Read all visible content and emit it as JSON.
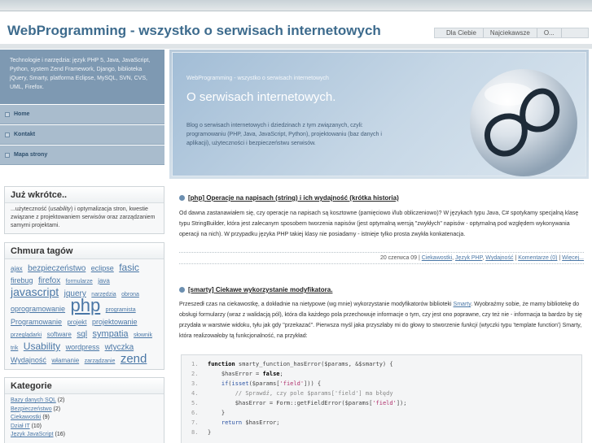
{
  "site": {
    "title": "WebProgramming - wszystko o serwisach internetowych",
    "top_nav": [
      "Dla Ciebie",
      "Najciekawsze",
      "O..."
    ]
  },
  "sidebar": {
    "intro": "Technologie i narzędzia: język PHP 5, Java, JavaScript, Python, system Zend Framework, Django, biblioteka jQuery, Smarty, platforma Eclipse, MySQL, SVN, CVS, UML, Firefox.",
    "nav": [
      "Home",
      "Kontakt",
      "Mapa strony"
    ],
    "soon": {
      "title": "Już wkrótce..",
      "text_before": "...użyteczność (",
      "text_em": "usability",
      "text_after": ") i optymalizacja stron, kwestie związane z projektowaniem serwisów oraz zarządzaniem samymi projektami."
    },
    "tags_title": "Chmura tagów",
    "tags": [
      {
        "label": "ajax",
        "size": 8
      },
      {
        "label": "bezpieczeństwo",
        "size": 10
      },
      {
        "label": "eclipse",
        "size": 9
      },
      {
        "label": "fasic",
        "size": 12
      },
      {
        "label": "firebug",
        "size": 9
      },
      {
        "label": "firefox",
        "size": 10
      },
      {
        "label": "formularze",
        "size": 7
      },
      {
        "label": "java",
        "size": 8
      },
      {
        "label": "javascript",
        "size": 14
      },
      {
        "label": "jquery",
        "size": 10
      },
      {
        "label": "narzędzia",
        "size": 7
      },
      {
        "label": "obrona",
        "size": 7
      },
      {
        "label": "oprogramowanie",
        "size": 9
      },
      {
        "label": "php",
        "size": 22
      },
      {
        "label": "programista",
        "size": 7
      },
      {
        "label": "Programowanie",
        "size": 9
      },
      {
        "label": "projekt",
        "size": 8
      },
      {
        "label": "projektowanie",
        "size": 9
      },
      {
        "label": "przeglądarki",
        "size": 7
      },
      {
        "label": "software",
        "size": 8
      },
      {
        "label": "sql",
        "size": 10
      },
      {
        "label": "sympatia",
        "size": 11
      },
      {
        "label": "słownik",
        "size": 7
      },
      {
        "label": "trik",
        "size": 7
      },
      {
        "label": "Usability",
        "size": 12
      },
      {
        "label": "wordpress",
        "size": 9
      },
      {
        "label": "wtyczka",
        "size": 10
      },
      {
        "label": "Wydajność",
        "size": 9
      },
      {
        "label": "włamanie",
        "size": 8
      },
      {
        "label": "zarządzanie",
        "size": 7
      },
      {
        "label": "zend",
        "size": 15
      }
    ],
    "categories_title": "Kategorie",
    "categories": [
      {
        "label": "Bazy danych SQL",
        "count": "(2)"
      },
      {
        "label": "Bezpieczeństwo",
        "count": "(2)"
      },
      {
        "label": "Ciekawostki",
        "count": "(9)"
      },
      {
        "label": "Dział IT",
        "count": "(10)"
      },
      {
        "label": "Język JavaScript",
        "count": "(16)"
      }
    ]
  },
  "banner": {
    "small": "WebProgramming - wszystko o serwisach internetowych",
    "title": "O serwisach internetowych.",
    "desc": "Blog o serwisach internetowych i dziedzinach z tym związanych, czyli: programowaniu (PHP, Java, JavaScript, Python), projektowaniu (baz danych i aplikacji), użyteczności i bezpieczeństwu serwisów."
  },
  "posts": [
    {
      "tag": "[php]",
      "title": "Operacje na napisach (string) i ich wydajność (krótka historia)",
      "body": "Od dawna zastanawiałem się, czy operacje na napisach są kosztowne (pamięciowo i/lub obliczeniowo)? W językach typu Java, C# spotykamy specjalną klasę typu StringBuilder, która jest zalecanym sposobem tworzenia napisów (jest optymalną wersją \"zwykłych\" napisów - optymalną pod względem wykonywania operacji na nich). W przypadku języka PHP takiej klasy nie posiadamy - istnieje tylko prosta zwykła konkatenacja.",
      "meta": {
        "date": "20 czerwca 09 |",
        "links": [
          "Ciekawostki",
          "Język PHP",
          "Wydajność",
          "Komentarze (0)",
          "Więcej..."
        ]
      }
    },
    {
      "tag": "[smarty]",
      "title": "Ciekawe wykorzystanie modyfikatora.",
      "body_1": "Przeszedł czas na ciekawostkę, a dokładnie na nietypowe (wg mnie) wykorzystanie modyfikatorów biblioteki ",
      "body_link": "Smarty",
      "body_2": ". Wyobraźmy sobie, że mamy bibliotekę do obsługi formularzy (wraz z walidacją pól), która dla każdego pola przechowuje informacje o tym, czy jest ono poprawne, czy też nie - informacja ta bardzo by się przydała w warstwie widoku, tyłu jak gdy \"przekazać\". Pierwsza myśl jaka przyszłaby mi do głowy to stworzenie ",
      "body_em": "funkcji",
      "body_3": " (wtyczki typu 'template function') Smarty, która realizowałoby tą funkcjonalność, na przykład:"
    }
  ],
  "code": [
    {
      "n": "1.",
      "parts": [
        [
          "kw",
          "function"
        ],
        [
          "",
          " smarty_function_hasError($params, &$smarty) {"
        ]
      ]
    },
    {
      "n": "2.",
      "parts": [
        [
          "",
          "    $hasError = "
        ],
        [
          "kw",
          "false"
        ],
        [
          "",
          ";"
        ]
      ]
    },
    {
      "n": "3.",
      "parts": [
        [
          "",
          "    "
        ],
        [
          "kw2",
          "if"
        ],
        [
          "",
          "("
        ],
        [
          "kw2",
          "isset"
        ],
        [
          "",
          "($params["
        ],
        [
          "str",
          "'field'"
        ],
        [
          "",
          "])) {"
        ]
      ]
    },
    {
      "n": "4.",
      "parts": [
        [
          "cm",
          "        // Sprawdź, czy pole $params['field'] ma błędy"
        ]
      ]
    },
    {
      "n": "5.",
      "parts": [
        [
          "",
          "        $hasError = Form::getFieldError($params["
        ],
        [
          "str",
          "'field'"
        ],
        [
          "",
          "]);"
        ]
      ]
    },
    {
      "n": "6.",
      "parts": [
        [
          "",
          "    }"
        ]
      ]
    },
    {
      "n": "7.",
      "parts": [
        [
          "",
          "    "
        ],
        [
          "kw2",
          "return"
        ],
        [
          "",
          " $hasError;"
        ]
      ]
    },
    {
      "n": "8.",
      "parts": [
        [
          "",
          "}"
        ]
      ]
    }
  ]
}
